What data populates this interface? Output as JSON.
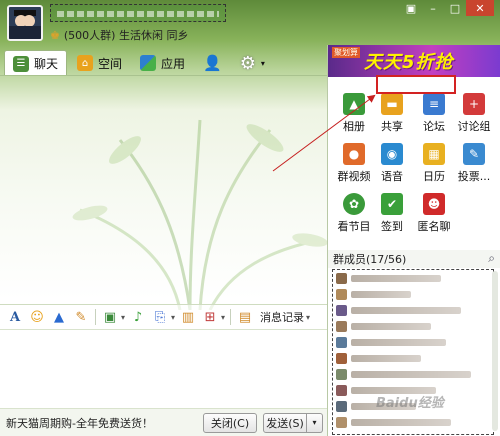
{
  "header": {
    "group_name": "",
    "sub_text": "(500人群) 生活休闲 同乡"
  },
  "tabs": [
    {
      "label": "聊天",
      "icon": "chat-icon"
    },
    {
      "label": "空间",
      "icon": "home-icon"
    },
    {
      "label": "应用",
      "icon": "apps-icon"
    }
  ],
  "toolbar": {
    "history_label": "消息记录"
  },
  "bottom": {
    "ad_text": "新天猫周期购-全年免费送货！",
    "close_label": "关闭(C)",
    "send_label": "发送(S)"
  },
  "banner": {
    "tag": "聚划算",
    "title": "天天5折抢"
  },
  "apps": [
    {
      "label": "相册",
      "icon": "photo-icon",
      "color": "#3a9a3a"
    },
    {
      "label": "共享",
      "icon": "folder-icon",
      "color": "#e8a21e"
    },
    {
      "label": "论坛",
      "icon": "forum-icon",
      "color": "#3a7ad0"
    },
    {
      "label": "讨论组",
      "icon": "discuss-icon",
      "color": "#d33a3a"
    },
    {
      "label": "群视频",
      "icon": "video-icon",
      "color": "#e06a2a"
    },
    {
      "label": "语音",
      "icon": "voice-icon",
      "color": "#2a8ad0"
    },
    {
      "label": "日历",
      "icon": "calendar-icon",
      "color": "#e8b020"
    },
    {
      "label": "投票...",
      "icon": "vote-icon",
      "color": "#3a8ad0"
    },
    {
      "label": "看节目",
      "icon": "tv-icon",
      "color": "#3a9a3a"
    },
    {
      "label": "签到",
      "icon": "checkin-icon",
      "color": "#3aa03a"
    },
    {
      "label": "匿名聊",
      "icon": "mask-icon",
      "color": "#d02a2a"
    }
  ],
  "members": {
    "header": "群成员(17/56)"
  },
  "watermark": "Baidu经验"
}
